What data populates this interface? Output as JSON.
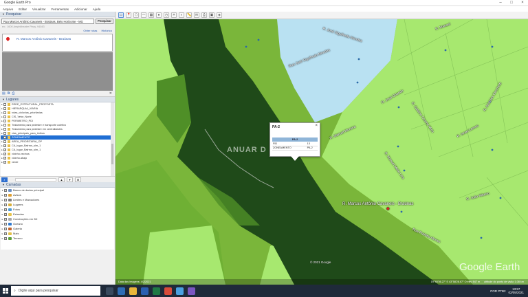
{
  "window": {
    "title": "Google Earth Pro",
    "controls": [
      "–",
      "□",
      "×"
    ]
  },
  "menu": [
    "Arquivo",
    "Editar",
    "Visualizar",
    "Ferramentas",
    "Adicionar",
    "Ajuda"
  ],
  "search": {
    "header": "Pesquisar",
    "value": "Rua Marcos Antônio Cavaneis - Braúnas, Belo Horizonte - MG",
    "button": "Pesquisar",
    "hint": "ex.: 1600 Amphitheatre Pkwy, 94043",
    "links": [
      "Obter rotas",
      "Histórico"
    ],
    "result": "R. Marcos Antônio Cavaneis - Braúnas"
  },
  "places": {
    "header": "Lugares",
    "items": [
      {
        "label": "REDE_ESTRUTURAL_PROPOSTA",
        "checked": false
      },
      {
        "label": "HIERARQUIA_VIARIA",
        "checked": false
      },
      {
        "label": "rotas_ciclovias_prioritarias",
        "checked": false
      },
      {
        "label": "CIS_Vetor_Norte",
        "checked": false
      },
      {
        "label": "PERIMETRO_PDI",
        "checked": false
      },
      {
        "label": "Tratamento para pedestre e transporte coletivo",
        "checked": false
      },
      {
        "label": "Tratamento para pedestre em centralidades",
        "checked": false
      },
      {
        "label": "vias_principais_para_ônibus",
        "checked": false
      },
      {
        "label": "ZONEAMENTO",
        "checked": true,
        "selected": true
      },
      {
        "label": "AREA_PRIORITARIA_OP",
        "checked": false
      },
      {
        "label": "CA_lugar_Bairros_sim_1",
        "checked": true
      },
      {
        "label": "CA_lugar_Bairros_sim_1",
        "checked": true
      },
      {
        "label": "vizinho.vecinos",
        "checked": true
      },
      {
        "label": "vizinho.abajo",
        "checked": true
      },
      {
        "label": "verde",
        "checked": true
      }
    ]
  },
  "layers": {
    "header": "Camadas",
    "items": [
      {
        "label": "Banco de dados principal",
        "color": "#6a8fc2"
      },
      {
        "label": "Avisos",
        "color": "#e0a030"
      },
      {
        "label": "Limites e Marcadores",
        "color": "#7c7c7c"
      },
      {
        "label": "Lugares",
        "color": "#d9b03a"
      },
      {
        "label": "Fotos",
        "color": "#4a9ad6"
      },
      {
        "label": "Estradas",
        "color": "#e8c54a"
      },
      {
        "label": "Construções em 3D",
        "color": "#a6a6a6"
      },
      {
        "label": "Oceano",
        "color": "#2f7ad0"
      },
      {
        "label": "Galeria",
        "color": "#c0642e"
      },
      {
        "label": "Mais",
        "color": "#e3c047"
      },
      {
        "label": "Terreno",
        "color": "#5c9e3a"
      }
    ]
  },
  "popup": {
    "title": "PA-2",
    "table_header": "PA-2",
    "rows": [
      {
        "key": "FID",
        "value": "13"
      },
      {
        "key": "ZONEAMENTO",
        "value": "PA-2"
      }
    ]
  },
  "map_labels": {
    "street_main": "R. Marcos Antônio Cavaneis - Braúnas",
    "streets": [
      "R. José Sigulfredo Mendes",
      "Rua José Sigulfredo Mendes",
      "R. Manoel",
      "R. José Orlando",
      "R. Galdino Cosme Melo",
      "R. Manuel Moreira",
      "R. Israel Lemos",
      "R. Manoel Mello Lins",
      "R. Aristides Cecchetti",
      "R. João Ribeiro",
      "Rua Prefeito Alonso"
    ],
    "watermark": "ANUAR D",
    "copyright": "© 2021 Google",
    "logo": "Google Earth"
  },
  "status": {
    "left": "Data das imagens: 4/2/2021",
    "coords": "19°48'36.27\" S  43°58'28.67\" O  elev 847 m",
    "eye": "altitude do ponto de visão  1.08 km"
  },
  "taskbar": {
    "search_placeholder": "Digite aqui para pesquisar",
    "time": "13:57",
    "date": "02/05/2021",
    "lang": "POR PTB2"
  },
  "colors": {
    "zone_dark": "#1f4a19",
    "zone_mid": "#4f8f27",
    "zone_light": "#a7e86f",
    "zone_blue": "#b9e1f2",
    "selected": "#1f6fd4"
  }
}
